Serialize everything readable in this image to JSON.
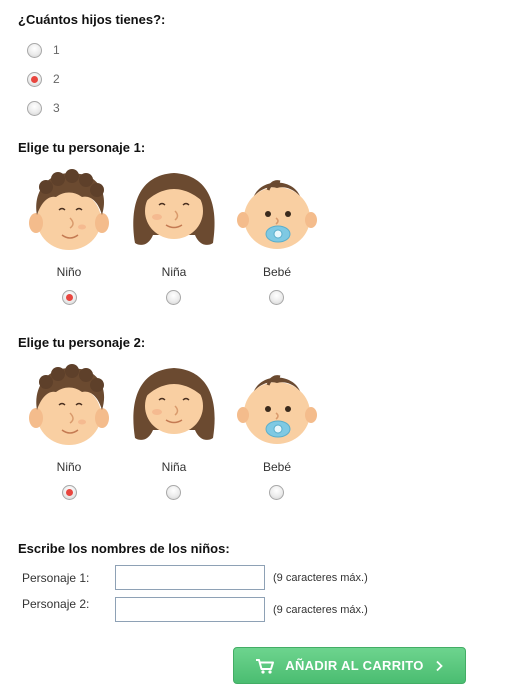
{
  "question_children": {
    "title": "¿Cuántos hijos tienes?:",
    "options": [
      "1",
      "2",
      "3"
    ],
    "selected": "2"
  },
  "character_1": {
    "title": "Elige tu personaje 1:",
    "options": [
      {
        "label": "Niño",
        "icon": "boy-face-icon"
      },
      {
        "label": "Niña",
        "icon": "girl-face-icon"
      },
      {
        "label": "Bebé",
        "icon": "baby-face-icon"
      }
    ],
    "selected": "Niño"
  },
  "character_2": {
    "title": "Elige tu personaje 2:",
    "options": [
      {
        "label": "Niño",
        "icon": "boy-face-icon"
      },
      {
        "label": "Niña",
        "icon": "girl-face-icon"
      },
      {
        "label": "Bebé",
        "icon": "baby-face-icon"
      }
    ],
    "selected": "Niño"
  },
  "names": {
    "title": "Escribe los nombres de los niños:",
    "fields": [
      {
        "label": "Personaje 1:",
        "value": "",
        "hint": "(9 caracteres máx.)"
      },
      {
        "label": "Personaje 2:",
        "value": "",
        "hint": "(9 caracteres máx.)"
      }
    ]
  },
  "cart_button": {
    "label": "AÑADIR AL CARRITO",
    "icon": "cart-icon",
    "arrow_icon": "chevron-right-icon",
    "color": "#5cc880"
  },
  "colors": {
    "selected_radio": "#e8463f",
    "skin": "#f9cfa2",
    "hair": "#6b4a30",
    "pacifier": "#7fc9e3"
  }
}
